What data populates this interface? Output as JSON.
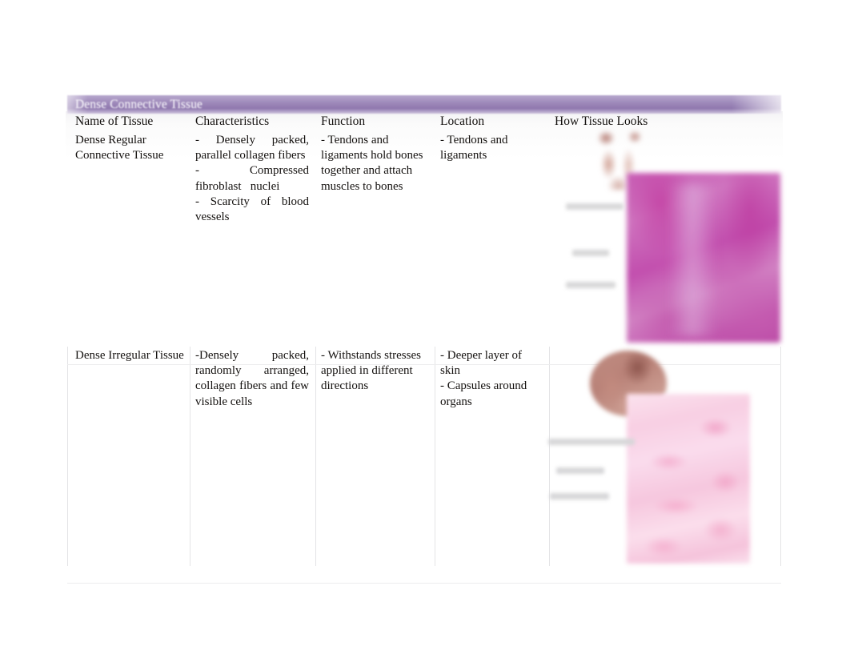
{
  "slide": {
    "title": "Dense Connective Tissue",
    "title_bar_color": "#9b86b8",
    "title_text_color": "#f2eef7",
    "background_color": "#ffffff"
  },
  "table": {
    "columns": [
      "Name of Tissue",
      "Characteristics",
      "Function",
      "Location",
      "How Tissue Looks"
    ],
    "rows": [
      {
        "name": "Dense Regular Connective Tissue",
        "characteristics": "- Densely packed, parallel collagen fibers\n- Compressed fibroblast   nuclei\n- Scarcity of blood vessels",
        "function": "- Tendons and ligaments hold bones together and attach muscles to bones",
        "location": "- Tendons and ligaments",
        "how_tissue_looks": {
          "image_alt": "dense-regular-connective-tissue-micrograph",
          "stain_color": "#c24fae",
          "diagram_alt": "tendon-ligament-anatomy-diagram",
          "label_text": ""
        }
      },
      {
        "name": "Dense Irregular Tissue",
        "characteristics": "-Densely packed, randomly   arranged, collagen fibers and few visible cells",
        "function": "- Withstands stresses applied in different directions",
        "location": "- Deeper layer of skin\n- Capsules around organs",
        "how_tissue_looks": {
          "image_alt": "dense-irregular-connective-tissue-micrograph",
          "stain_color": "#f5c3db",
          "diagram_alt": "skin-layer-anatomy-diagram",
          "label_text": ""
        }
      }
    ]
  }
}
